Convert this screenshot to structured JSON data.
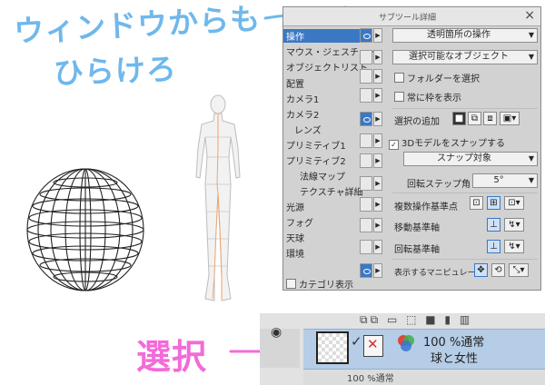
{
  "annotations": {
    "note_line1": "ウィンドウからも",
    "note_line2": "ひらけろ",
    "note_select": "選択"
  },
  "panel": {
    "title": "サブツール詳細",
    "close": "×",
    "categories": [
      "操作",
      "マウス・ジェスチャー",
      "オブジェクトリスト",
      "配置",
      "カメラ1",
      "カメラ2",
      "レンズ",
      "プリミティブ1",
      "プリミティブ2",
      "法線マップ",
      "テクスチャ詳細",
      "光源",
      "フォグ",
      "天球",
      "環境"
    ],
    "selected_category": "操作",
    "show_categories": "カテゴリ表示",
    "props": {
      "op_target": "透明箇所の操作",
      "selectable_objects": "選択可能なオブジェクト",
      "folder_select": "フォルダーを選択",
      "always_frame": "常に枠を表示",
      "add_selection_label": "選択の追加",
      "snap_3d": "3Dモデルをスナップする",
      "snap_target": "スナップ対象",
      "rotation_step_label": "回転ステップ角",
      "rotation_step_value": "5°",
      "multi_op_base_label": "複数操作基準点",
      "move_axis_label": "移動基準軸",
      "rotate_axis_label": "回転基準軸",
      "manipulator_label": "表示するマニピュレータ"
    }
  },
  "layer": {
    "opacity_blend": "100 %通常",
    "name": "球と女性",
    "next_row": "100 %通常"
  },
  "colors": {
    "panel_bg": "#d2d2d2",
    "selection_blue": "#3b78c4",
    "layer_selected": "#b5cde6",
    "note_blue": "#6fb8ec",
    "note_pink": "#f36ad8"
  }
}
